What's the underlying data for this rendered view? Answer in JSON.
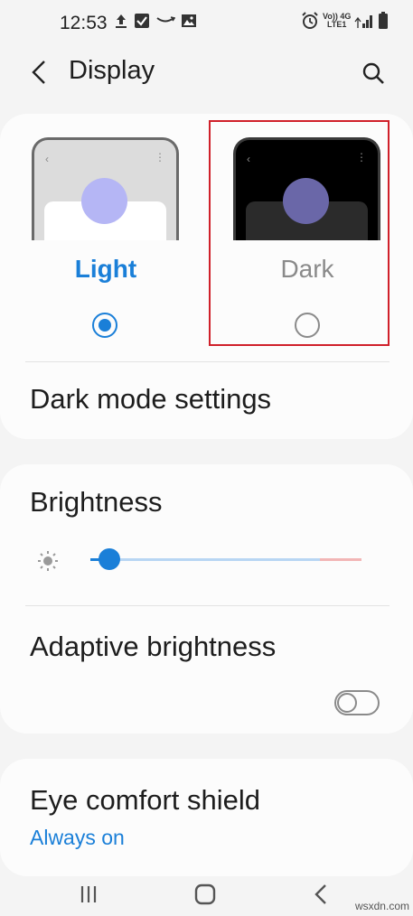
{
  "status_bar": {
    "time": "12:53",
    "left_icons": [
      "upload-icon",
      "checkbox-icon",
      "amazon-icon",
      "gallery-icon"
    ],
    "right_icons": [
      "alarm-icon",
      "volte-icon",
      "signal-icon",
      "battery-icon"
    ],
    "network_top": "Vo)) 4G",
    "network_bottom": "LTE1"
  },
  "header": {
    "back_icon": "chevron-left-icon",
    "title": "Display",
    "search_icon": "search-icon"
  },
  "theme": {
    "options": [
      {
        "label": "Light",
        "selected": true
      },
      {
        "label": "Dark",
        "selected": false
      }
    ],
    "accent_color": "#1a7fd8",
    "highlight_color": "#d0202a"
  },
  "dark_mode_settings": {
    "label": "Dark mode settings"
  },
  "brightness": {
    "label": "Brightness",
    "level": 0.07
  },
  "adaptive_brightness": {
    "label": "Adaptive brightness",
    "enabled": false
  },
  "eye_comfort": {
    "label": "Eye comfort shield",
    "status": "Always on"
  },
  "nav_bar": {
    "icons": [
      "recents-icon",
      "home-icon",
      "back-icon"
    ]
  },
  "watermark": "wsxdn.com"
}
